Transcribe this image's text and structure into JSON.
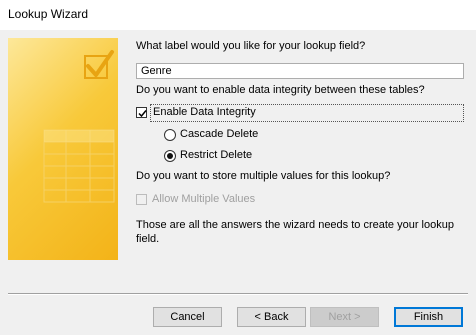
{
  "window": {
    "title": "Lookup Wizard"
  },
  "form": {
    "q_label": "What label would you like for your lookup field?",
    "label_value": "Genre",
    "q_integrity": "Do you want to enable data integrity between these tables?",
    "enable_integrity_label": "Enable Data Integrity",
    "enable_integrity_checked": true,
    "cascade_delete_label": "Cascade Delete",
    "restrict_delete_label": "Restrict Delete",
    "selected_delete_option": "Restrict Delete",
    "q_multiple": "Do you want to store multiple values for this lookup?",
    "allow_multiple_label": "Allow Multiple Values",
    "allow_multiple_enabled": false,
    "summary_line1": "Those are all the answers the wizard needs to create your lookup",
    "summary_line2": "field."
  },
  "buttons": {
    "cancel": "Cancel",
    "back": "< Back",
    "next": "Next >",
    "finish": "Finish"
  },
  "colors": {
    "art_yellow": "#f8c93a",
    "accent": "#0078d7"
  },
  "icons": [
    "checkmark-icon",
    "table-grid-icon"
  ]
}
